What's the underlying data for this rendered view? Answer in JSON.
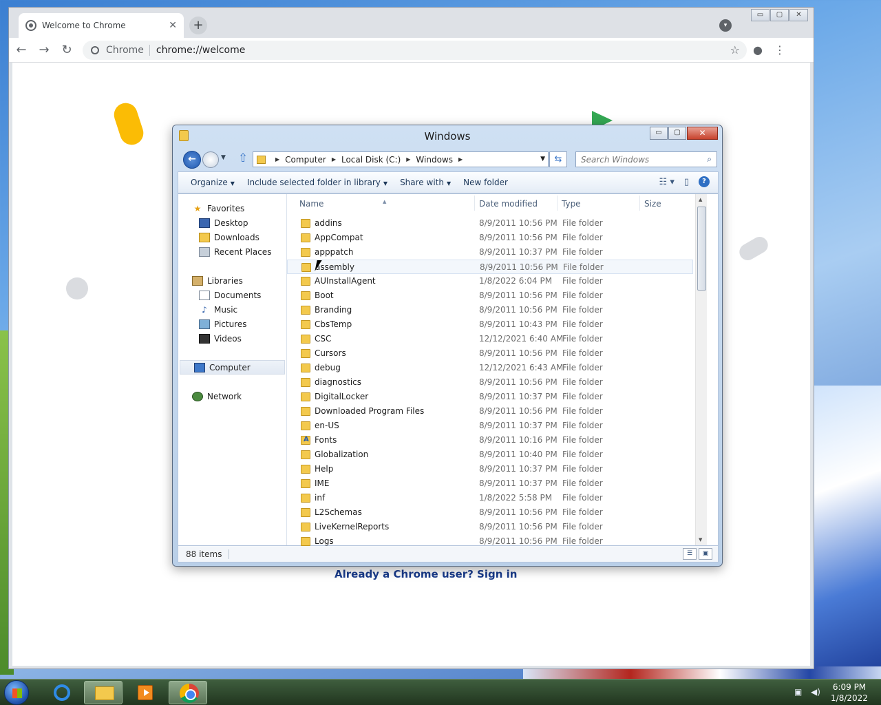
{
  "chrome": {
    "tab_title": "Welcome to Chrome",
    "tab_close": "✕",
    "new_tab": "+",
    "site_name": "Chrome",
    "url": "chrome://welcome",
    "signin_text": "Already a Chrome user? Sign in",
    "win_min": "▭",
    "win_max": "▢",
    "win_close": "✕"
  },
  "explorer": {
    "title": "Windows",
    "breadcrumbs": [
      "Computer",
      "Local Disk (C:)",
      "Windows"
    ],
    "search_placeholder": "Search Windows",
    "commands": {
      "organize": "Organize",
      "include": "Include selected folder in library",
      "share": "Share with",
      "new_folder": "New folder"
    },
    "nav": {
      "favorites": "Favorites",
      "desktop": "Desktop",
      "downloads": "Downloads",
      "recent": "Recent Places",
      "libraries": "Libraries",
      "documents": "Documents",
      "music": "Music",
      "pictures": "Pictures",
      "videos": "Videos",
      "computer": "Computer",
      "network": "Network"
    },
    "columns": {
      "name": "Name",
      "date": "Date modified",
      "type": "Type",
      "size": "Size"
    },
    "files": [
      {
        "name": "addins",
        "date": "8/9/2011 10:56 PM",
        "type": "File folder"
      },
      {
        "name": "AppCompat",
        "date": "8/9/2011 10:56 PM",
        "type": "File folder"
      },
      {
        "name": "apppatch",
        "date": "8/9/2011 10:37 PM",
        "type": "File folder"
      },
      {
        "name": "assembly",
        "date": "8/9/2011 10:56 PM",
        "type": "File folder"
      },
      {
        "name": "AUInstallAgent",
        "date": "1/8/2022 6:04 PM",
        "type": "File folder"
      },
      {
        "name": "Boot",
        "date": "8/9/2011 10:56 PM",
        "type": "File folder"
      },
      {
        "name": "Branding",
        "date": "8/9/2011 10:56 PM",
        "type": "File folder"
      },
      {
        "name": "CbsTemp",
        "date": "8/9/2011 10:43 PM",
        "type": "File folder"
      },
      {
        "name": "CSC",
        "date": "12/12/2021 6:40 AM",
        "type": "File folder"
      },
      {
        "name": "Cursors",
        "date": "8/9/2011 10:56 PM",
        "type": "File folder"
      },
      {
        "name": "debug",
        "date": "12/12/2021 6:43 AM",
        "type": "File folder"
      },
      {
        "name": "diagnostics",
        "date": "8/9/2011 10:56 PM",
        "type": "File folder"
      },
      {
        "name": "DigitalLocker",
        "date": "8/9/2011 10:37 PM",
        "type": "File folder"
      },
      {
        "name": "Downloaded Program Files",
        "date": "8/9/2011 10:56 PM",
        "type": "File folder"
      },
      {
        "name": "en-US",
        "date": "8/9/2011 10:37 PM",
        "type": "File folder"
      },
      {
        "name": "Fonts",
        "date": "8/9/2011 10:16 PM",
        "type": "File folder"
      },
      {
        "name": "Globalization",
        "date": "8/9/2011 10:40 PM",
        "type": "File folder"
      },
      {
        "name": "Help",
        "date": "8/9/2011 10:37 PM",
        "type": "File folder"
      },
      {
        "name": "IME",
        "date": "8/9/2011 10:37 PM",
        "type": "File folder"
      },
      {
        "name": "inf",
        "date": "1/8/2022 5:58 PM",
        "type": "File folder"
      },
      {
        "name": "L2Schemas",
        "date": "8/9/2011 10:56 PM",
        "type": "File folder"
      },
      {
        "name": "LiveKernelReports",
        "date": "8/9/2011 10:56 PM",
        "type": "File folder"
      },
      {
        "name": "Logs",
        "date": "8/9/2011 10:56 PM",
        "type": "File folder"
      }
    ],
    "status_count": "88 items"
  },
  "taskbar": {
    "time": "6:09 PM",
    "date": "1/8/2022"
  },
  "colors": {
    "accent": "#3a76c8",
    "folder": "#f3c94d"
  }
}
